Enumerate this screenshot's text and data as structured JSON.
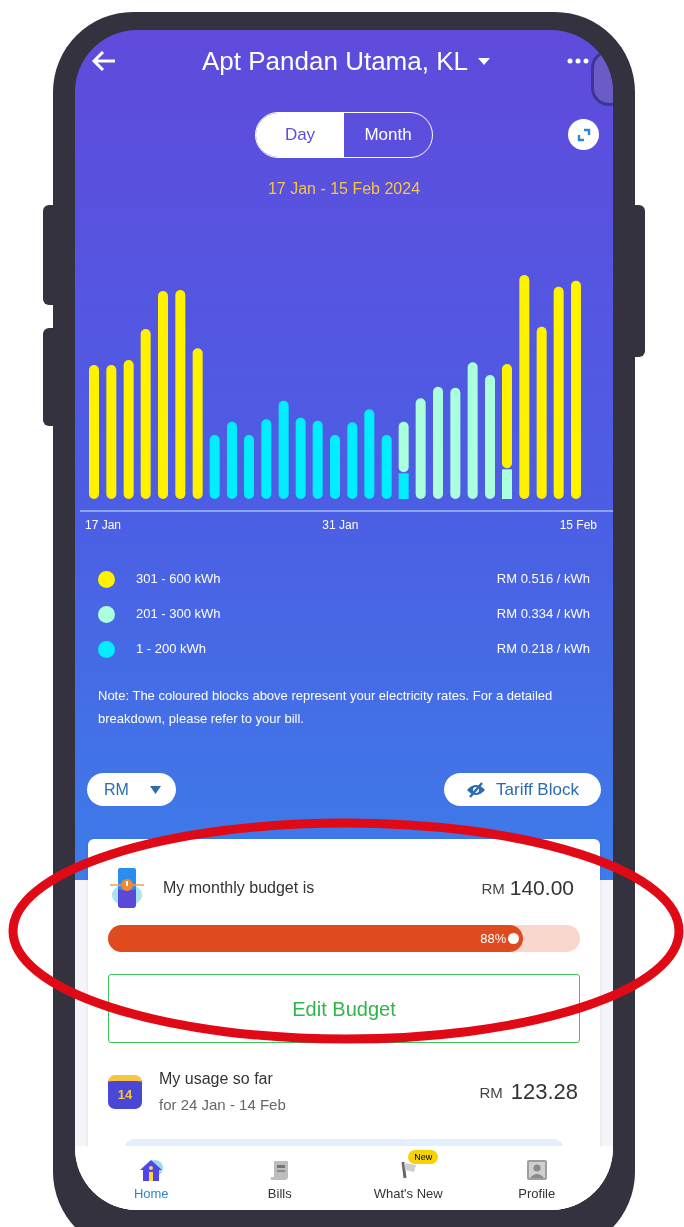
{
  "header": {
    "title": "Apt Pandan Utama, KL"
  },
  "period_tabs": [
    {
      "label": "Day",
      "selected": true
    },
    {
      "label": "Month",
      "selected": false
    }
  ],
  "date_range": "17 Jan - 15 Feb 2024",
  "chart_axis_labels": [
    "17 Jan",
    "31 Jan",
    "15 Feb"
  ],
  "legend": [
    {
      "range": "301 - 600 kWh",
      "rate": "RM 0.516 / kWh",
      "color": "#fff200"
    },
    {
      "range": "201 - 300 kWh",
      "rate": "RM 0.334 / kWh",
      "color": "#aaffdd"
    },
    {
      "range": "1 - 200 kWh",
      "rate": "RM 0.218 / kWh",
      "color": "#00eeff"
    }
  ],
  "note": "Note: The coloured blocks above represent your electricity rates. For a detailed breakdown, please refer to your bill.",
  "currency_select": {
    "value": "RM"
  },
  "tariff_button": {
    "label": "Tariff Block"
  },
  "budget": {
    "label": "My monthly budget is",
    "currency": "RM",
    "amount": "140.00",
    "level": 0.88,
    "percent": "88%",
    "button": "Edit Budget"
  },
  "usage": {
    "label": "My usage so far",
    "period": "for 24 Jan - 14 Feb",
    "currency": "RM",
    "amount": "123.28",
    "icon_day": "14"
  },
  "nav": [
    {
      "label": "Home",
      "selected": true
    },
    {
      "label": "Bills",
      "selected": false
    },
    {
      "label": "What's New",
      "selected": false,
      "badge": "New"
    },
    {
      "label": "Profile",
      "selected": false
    }
  ]
}
